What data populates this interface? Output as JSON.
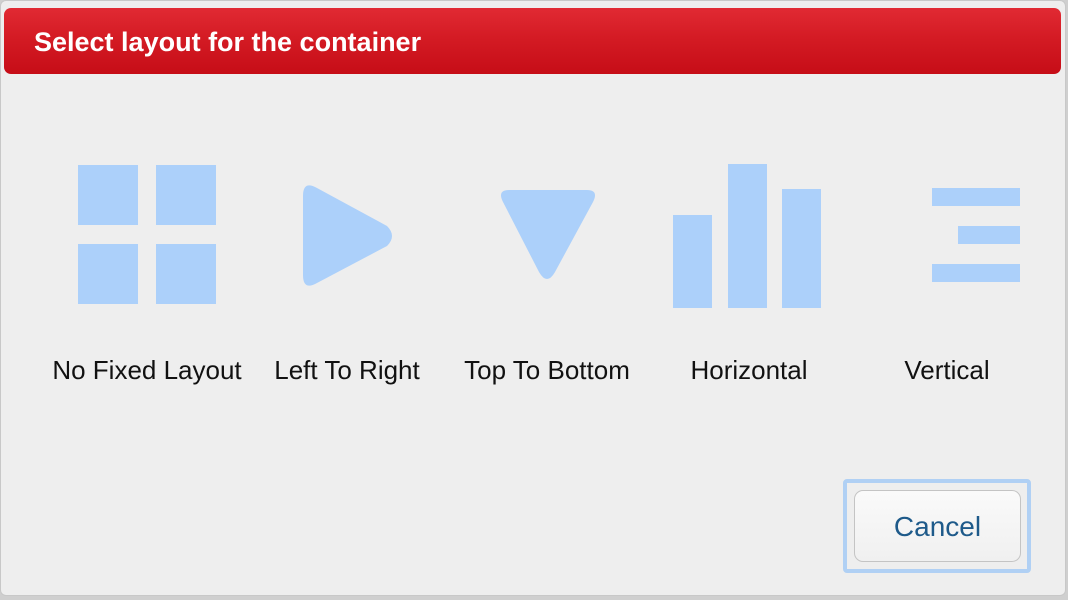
{
  "dialog": {
    "title": "Select layout for the container"
  },
  "icon_color": "#acd0fa",
  "title_color": "#d41b24",
  "options": [
    {
      "label": "No Fixed Layout",
      "icon": "grid-icon"
    },
    {
      "label": "Left To Right",
      "icon": "play-right-icon"
    },
    {
      "label": "Top To Bottom",
      "icon": "triangle-down-icon"
    },
    {
      "label": "Horizontal",
      "icon": "bars-icon"
    },
    {
      "label": "Vertical",
      "icon": "stacked-lines-icon"
    }
  ],
  "buttons": {
    "cancel_label": "Cancel"
  }
}
